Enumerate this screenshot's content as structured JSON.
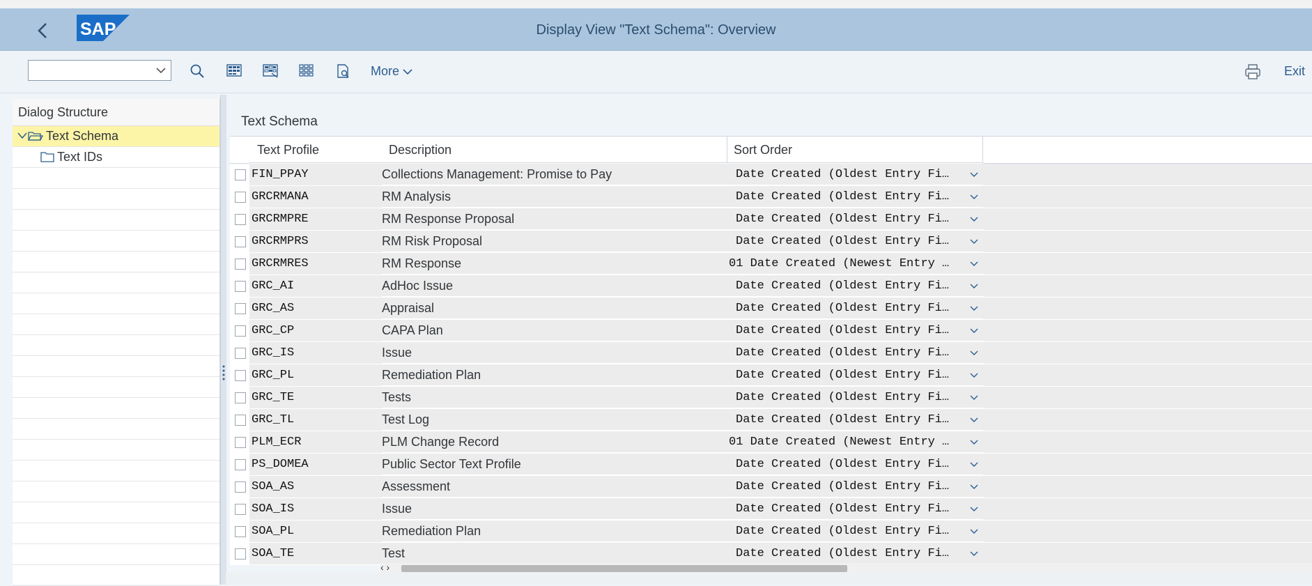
{
  "header": {
    "title": "Display View \"Text Schema\": Overview",
    "logo_text": "SAP",
    "brand_color": "#1a6ec8",
    "bar_color": "#abc5de"
  },
  "toolbar": {
    "combo_value": "",
    "more_label": "More",
    "exit_label": "Exit",
    "icons": [
      "search-icon",
      "select-all-icon",
      "deselect-all-icon",
      "select-block-icon",
      "print-preview-icon"
    ]
  },
  "dialog_structure": {
    "title": "Dialog Structure",
    "items": [
      {
        "label": "Text Schema",
        "selected": true,
        "expanded": true
      },
      {
        "label": "Text IDs",
        "selected": false
      }
    ]
  },
  "table": {
    "title": "Text Schema",
    "columns": [
      "Text Profile",
      "Description",
      "Sort Order"
    ],
    "rows": [
      {
        "profile": "FIN_PPAY",
        "description": "Collections Management: Promise to Pay",
        "sort": "Date Created (Oldest Entry Fi…"
      },
      {
        "profile": "GRCRMANA",
        "description": "RM Analysis",
        "sort": "Date Created (Oldest Entry Fi…"
      },
      {
        "profile": "GRCRMPRE",
        "description": "RM Response Proposal",
        "sort": "Date Created (Oldest Entry Fi…"
      },
      {
        "profile": "GRCRMPRS",
        "description": "RM Risk Proposal",
        "sort": "Date Created (Oldest Entry Fi…"
      },
      {
        "profile": "GRCRMRES",
        "description": "RM Response",
        "sort": "01 Date Created (Newest Entry …"
      },
      {
        "profile": "GRC_AI",
        "description": "AdHoc Issue",
        "sort": "Date Created (Oldest Entry Fi…"
      },
      {
        "profile": "GRC_AS",
        "description": "Appraisal",
        "sort": "Date Created (Oldest Entry Fi…"
      },
      {
        "profile": "GRC_CP",
        "description": "CAPA Plan",
        "sort": "Date Created (Oldest Entry Fi…"
      },
      {
        "profile": "GRC_IS",
        "description": "Issue",
        "sort": "Date Created (Oldest Entry Fi…"
      },
      {
        "profile": "GRC_PL",
        "description": "Remediation Plan",
        "sort": "Date Created (Oldest Entry Fi…"
      },
      {
        "profile": "GRC_TE",
        "description": "Tests",
        "sort": "Date Created (Oldest Entry Fi…"
      },
      {
        "profile": "GRC_TL",
        "description": "Test Log",
        "sort": "Date Created (Oldest Entry Fi…"
      },
      {
        "profile": "PLM_ECR",
        "description": "PLM Change Record",
        "sort": "01 Date Created (Newest Entry …"
      },
      {
        "profile": "PS_DOMEA",
        "description": "Public Sector Text Profile",
        "sort": "Date Created (Oldest Entry Fi…"
      },
      {
        "profile": "SOA_AS",
        "description": "Assessment",
        "sort": "Date Created (Oldest Entry Fi…"
      },
      {
        "profile": "SOA_IS",
        "description": "Issue",
        "sort": "Date Created (Oldest Entry Fi…"
      },
      {
        "profile": "SOA_PL",
        "description": "Remediation Plan",
        "sort": "Date Created (Oldest Entry Fi…"
      },
      {
        "profile": "SOA_TE",
        "description": "Test",
        "sort": "Date Created (Oldest Entry Fi…"
      }
    ]
  }
}
